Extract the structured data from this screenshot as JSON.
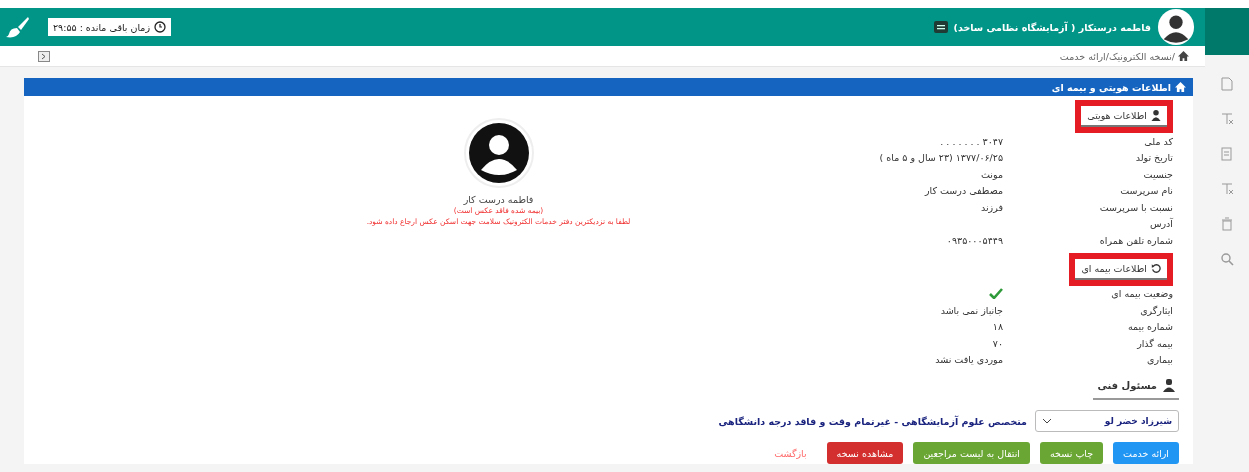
{
  "header": {
    "user_name": "فاطمه درستکار ( آزمایشگاه نظامی ساخد)",
    "timer": "زمان باقی مانده : ۲۹:۵۵"
  },
  "breadcrumb": "/نسخه الکترونیک/ارائه خدمت",
  "panel_title": "اطلاعات هویتی و بیمه ای",
  "sections": [
    {
      "title": "اطلاعات هویتی",
      "highlighted": true,
      "rows": [
        {
          "kind": "text",
          "label": "کد ملی",
          "value": "۳۰۴۷ . . . . . . ."
        },
        {
          "kind": "text",
          "label": "تاریخ تولد",
          "value": "۱۳۷۷/۰۶/۲۵ (۲۳ سال و ۵ ماه )"
        },
        {
          "kind": "text",
          "label": "جنسیت",
          "value": "مونث"
        },
        {
          "kind": "text",
          "label": "نام سرپرست",
          "value": "مصطفی درست کار"
        },
        {
          "kind": "text",
          "label": "نسبت با سرپرست",
          "value": "فرزند"
        },
        {
          "kind": "text",
          "label": "آدرس"
        },
        {
          "kind": "text",
          "label": "شماره تلفن همراه",
          "value": "۰۹۳۵۰۰۰۵۴۴۹"
        }
      ]
    },
    {
      "title": "اطلاعات بیمه ای",
      "highlighted": true,
      "rows": [
        {
          "kind": "check",
          "label": "وضعیت بیمه ای",
          "ok": true
        },
        {
          "kind": "text",
          "label": "ایثارگری",
          "value": "جانباز نمی باشد"
        },
        {
          "kind": "text",
          "label": "شماره بیمه",
          "value": "۱۸"
        },
        {
          "kind": "text",
          "label": "بیمه گذار",
          "value": "۷۰"
        },
        {
          "kind": "text",
          "label": "بیماری",
          "value": "موردی یافت نشد"
        }
      ]
    }
  ],
  "profile": {
    "name": "فاطمه درست کار",
    "notice": "(بیمه شده فاقد عکس است)",
    "hint": "لطفا به نزدیکترین دفتر خدمات الکترونیک سلامت جهت اسکن عکس ارجاع داده شود."
  },
  "technician": {
    "title": "مسئول فنی",
    "selected_name": "شیرزاد خضر لو",
    "description": "متخصص علوم آزمایشگاهی - غیرتمام وقت و فاقد درجه دانشگاهی"
  },
  "buttons": [
    {
      "kind": "button",
      "label": "ارائه خدمت",
      "color": "#2196f3"
    },
    {
      "kind": "button",
      "label": "چاپ نسخه",
      "color": "#6aa633"
    },
    {
      "kind": "button",
      "label": "انتقال به لیست مراجعین",
      "color": "#6aa633"
    },
    {
      "kind": "button",
      "label": "مشاهده نسخه",
      "color": "#d32f2f"
    },
    {
      "kind": "link",
      "label": "بازگشت",
      "color": "#ff6b6b"
    }
  ]
}
